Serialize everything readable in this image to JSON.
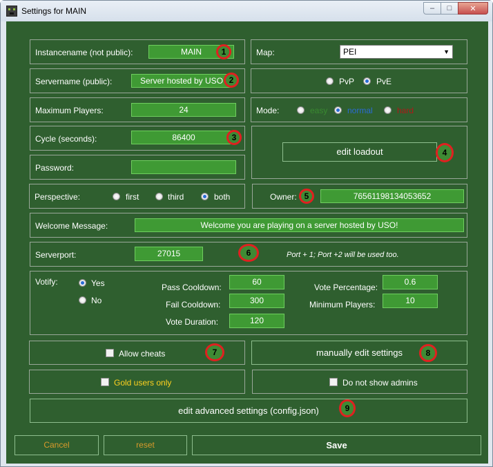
{
  "window": {
    "title": "Settings for MAIN",
    "minimize": "–",
    "maximize": "□",
    "close": "✕"
  },
  "instance": {
    "label": "Instancename (not public):",
    "value": "MAIN"
  },
  "map": {
    "label": "Map:",
    "value": "PEI"
  },
  "servername": {
    "label": "Servername (public):",
    "value": "Server hosted by USO"
  },
  "pvp": {
    "pvp_label": "PvP",
    "pve_label": "PvE",
    "selected": "PvE"
  },
  "maxplayers": {
    "label": "Maximum Players:",
    "value": "24"
  },
  "mode": {
    "label": "Mode:",
    "easy": "easy",
    "normal": "normal",
    "hard": "hard",
    "selected": "normal",
    "easy_color": "#3a8a30",
    "normal_color": "#2a6bd6",
    "hard_color": "#b01818"
  },
  "cycle": {
    "label": "Cycle (seconds):",
    "value": "86400"
  },
  "loadout": {
    "button": "edit loadout"
  },
  "password": {
    "label": "Password:",
    "value": ""
  },
  "perspective": {
    "label": "Perspective:",
    "first": "first",
    "third": "third",
    "both": "both",
    "selected": "both"
  },
  "owner": {
    "label": "Owner:",
    "value": "76561198134053652"
  },
  "welcome": {
    "label": "Welcome Message:",
    "value": "Welcome you are playing on a server hosted by USO!"
  },
  "serverport": {
    "label": "Serverport:",
    "value": "27015",
    "note": "Port + 1; Port +2 will be used too."
  },
  "votify": {
    "label": "Votify:",
    "yes": "Yes",
    "no": "No",
    "selected": "Yes",
    "pass_cooldown_label": "Pass Cooldown:",
    "pass_cooldown": "60",
    "fail_cooldown_label": "Fail Cooldown:",
    "fail_cooldown": "300",
    "vote_duration_label": "Vote Duration:",
    "vote_duration": "120",
    "vote_percentage_label": "Vote Percentage:",
    "vote_percentage": "0.6",
    "min_players_label": "Minimum Players:",
    "min_players": "10"
  },
  "cheats": {
    "label": "Allow cheats",
    "checked": false
  },
  "manual": {
    "button": "manually edit settings"
  },
  "gold": {
    "label": "Gold users only",
    "checked": false,
    "color": "#ffd21f"
  },
  "admins": {
    "label": "Do not show admins",
    "checked": false
  },
  "advanced": {
    "button": "edit advanced settings (config.json)"
  },
  "footer": {
    "cancel": "Cancel",
    "reset": "reset",
    "save": "Save",
    "accent": "#d99a2b"
  },
  "annotations": [
    "1",
    "2",
    "3",
    "4",
    "5",
    "6",
    "7",
    "8",
    "9"
  ],
  "colors": {
    "background": "#2f5f2f",
    "field": "#3f9a34",
    "marker": "#e02020"
  }
}
